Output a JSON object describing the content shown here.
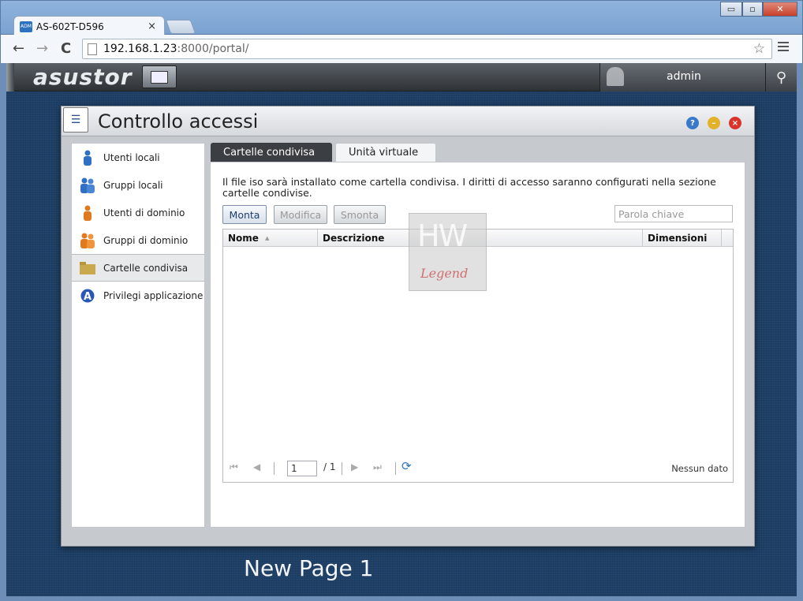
{
  "browser": {
    "tab_title": "AS-602T-D596",
    "tab_close": "×",
    "url_host": "192.168.1.23",
    "url_rest": ":8000/portal/",
    "back": "←",
    "forward": "→",
    "reload": "C",
    "star": "☆",
    "win_minimize": "▭",
    "win_maximize": "▫",
    "win_close": "✕"
  },
  "admbar": {
    "logo": "asustor",
    "user": "admin",
    "search_icon": "search-icon"
  },
  "window": {
    "title": "Controllo accessi",
    "help": "?",
    "minimize": "–",
    "close": "×"
  },
  "sidebar": {
    "items": [
      {
        "label": "Utenti locali",
        "icon": "user-icon"
      },
      {
        "label": "Gruppi locali",
        "icon": "group-icon"
      },
      {
        "label": "Utenti di dominio",
        "icon": "domain-user-icon"
      },
      {
        "label": "Gruppi di dominio",
        "icon": "domain-group-icon"
      },
      {
        "label": "Cartelle condivisa",
        "icon": "folder-icon"
      },
      {
        "label": "Privilegi applicazione",
        "icon": "app-icon"
      }
    ]
  },
  "tabs": [
    "Cartelle condivisa",
    "Unità virtuale"
  ],
  "panel": {
    "info": "Il file iso sarà installato come cartella condivisa. I diritti di accesso saranno configurati nella sezione cartelle condivise.",
    "buttons": {
      "mount": "Monta",
      "edit": "Modifica",
      "unmount": "Smonta"
    },
    "search_placeholder": "Parola chiave",
    "columns": {
      "name": "Nome",
      "sort": "▲",
      "description": "Descrizione",
      "size": "Dimensioni"
    },
    "pager": {
      "first": "⏮",
      "prev": "◀",
      "page": "1",
      "of": "/ 1",
      "next": "▶",
      "last": "⏭",
      "refresh": "⟳",
      "empty": "Nessun dato"
    }
  },
  "watermark": {
    "top": "HW",
    "bottom": "Legend"
  },
  "caption": "New Page 1",
  "colors": {
    "desktop": "#1e3f66",
    "active_tab": "#3b3e42",
    "accent": "#2d72c0"
  }
}
